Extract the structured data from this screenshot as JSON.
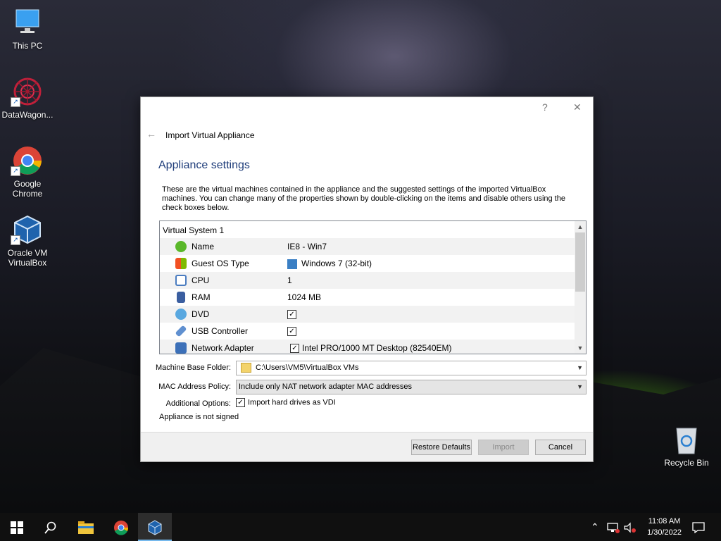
{
  "desktop": {
    "icons": [
      {
        "label": "This PC"
      },
      {
        "label": "DataWagon..."
      },
      {
        "label": "Google Chrome"
      },
      {
        "label": "Oracle VM VirtualBox"
      },
      {
        "label": "Recycle Bin"
      }
    ]
  },
  "dialog": {
    "help_symbol": "?",
    "close_symbol": "✕",
    "back_symbol": "←",
    "wizard_title": "Import Virtual Appliance",
    "heading": "Appliance settings",
    "description": "These are the virtual machines contained in the appliance and the suggested settings of the imported VirtualBox machines. You can change many of the properties shown by double-clicking on the items and disable others using the check boxes below.",
    "tree": {
      "root": "Virtual System 1",
      "rows": [
        {
          "label": "Name",
          "value": "IE8 - Win7",
          "icon": "name-icon",
          "color": "#5ab82a"
        },
        {
          "label": "Guest OS Type",
          "value": "Windows 7 (32-bit)",
          "icon": "os-icon",
          "color": "#f0a020"
        },
        {
          "label": "CPU",
          "value": "1",
          "icon": "cpu-icon",
          "color": "#4a7cc0"
        },
        {
          "label": "RAM",
          "value": "1024 MB",
          "icon": "ram-icon",
          "color": "#3a5ea0"
        },
        {
          "label": "DVD",
          "value": "",
          "checked": true,
          "icon": "dvd-icon",
          "color": "#59a8e0"
        },
        {
          "label": "USB Controller",
          "value": "",
          "checked": true,
          "icon": "usb-icon",
          "color": "#6090d0"
        },
        {
          "label": "Network Adapter",
          "value": "Intel PRO/1000 MT Desktop (82540EM)",
          "checked": true,
          "icon": "network-icon",
          "color": "#3c70b8"
        }
      ]
    },
    "machine_base_folder": {
      "label": "Machine Base Folder:",
      "value": "C:\\Users\\VM5\\VirtualBox VMs"
    },
    "mac_policy": {
      "label": "MAC Address Policy:",
      "value": "Include only NAT network adapter MAC addresses"
    },
    "additional_options": {
      "label": "Additional Options:",
      "checkbox_label": "Import hard drives as VDI",
      "checked": true
    },
    "signature_status": "Appliance is not signed",
    "buttons": {
      "restore": "Restore Defaults",
      "import": "Import",
      "cancel": "Cancel"
    }
  },
  "taskbar": {
    "time": "11:08 AM",
    "date": "1/30/2022"
  }
}
